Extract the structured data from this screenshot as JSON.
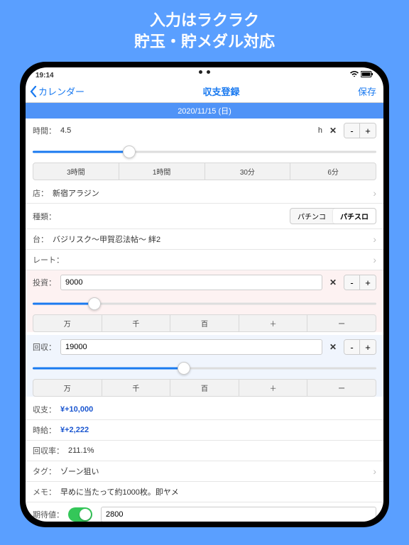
{
  "headline": {
    "l1": "入力はラクラク",
    "l2": "貯玉・貯メダル対応"
  },
  "status": {
    "time": "19:14"
  },
  "nav": {
    "back": "カレンダー",
    "title": "収支登録",
    "save": "保存"
  },
  "date": "2020/11/15 (日)",
  "time": {
    "label": "時間：",
    "value": "4.5",
    "unit": "h"
  },
  "time_presets": [
    "3時間",
    "1時間",
    "30分",
    "6分"
  ],
  "store": {
    "label": "店：",
    "value": "新宿アラジン"
  },
  "type": {
    "label": "種類：",
    "options": [
      "パチンコ",
      "パチスロ"
    ],
    "active": 1
  },
  "machine": {
    "label": "台：",
    "value": "バジリスク～甲賀忍法帖～ 絆2"
  },
  "rate": {
    "label": "レート："
  },
  "invest": {
    "label": "投資：",
    "value": "9000"
  },
  "collect": {
    "label": "回収：",
    "value": "19000"
  },
  "amount_presets": [
    "万",
    "千",
    "百",
    "＋",
    "ー"
  ],
  "balance": {
    "label": "収支：",
    "value": "¥+10,000"
  },
  "wage": {
    "label": "時給：",
    "value": "¥+2,222"
  },
  "recovery": {
    "label": "回収率：",
    "value": "211.1%"
  },
  "tag": {
    "label": "タグ：",
    "value": "ゾーン狙い"
  },
  "memo": {
    "label": "メモ：",
    "value": "早めに当たって約1000枚。即ヤメ"
  },
  "expect": {
    "label": "期待値：",
    "value": "2800"
  },
  "controls": {
    "minus": "-",
    "plus": "+",
    "clear": "✕"
  }
}
